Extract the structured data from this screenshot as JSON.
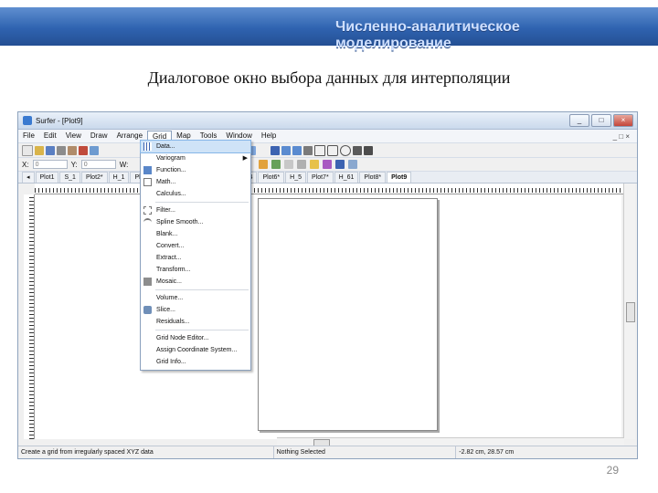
{
  "slide": {
    "banner_title": "Численно-аналитическое моделирование",
    "heading": "Диалоговое окно выбора данных для интерполяции",
    "page_number": "29"
  },
  "window": {
    "title": "Surfer - [Plot9]",
    "buttons": [
      "_",
      "□",
      "×"
    ]
  },
  "menubar": {
    "items": [
      "File",
      "Edit",
      "View",
      "Draw",
      "Arrange",
      "Grid",
      "Map",
      "Tools",
      "Window",
      "Help"
    ],
    "active": "Grid",
    "mdi_controls": "_ □ ×"
  },
  "coords": {
    "x_label": "X:",
    "x_value": "0",
    "y_label": "Y:",
    "y_value": "0",
    "w_label": "W:"
  },
  "tabs": {
    "left_items": [
      "Plot1",
      "S_1",
      "Plot2*",
      "H_1",
      "Plo"
    ],
    "right_items": [
      "H_4",
      "Plot6*",
      "H_5",
      "Plot7*",
      "H_61",
      "Plot8*",
      "Plot9"
    ],
    "active": "Plot9"
  },
  "grid_menu": {
    "items": [
      {
        "label": "Data...",
        "icon": "grid-data-icon",
        "highlight": true
      },
      {
        "label": "Variogram",
        "submenu": "▶"
      },
      {
        "label": "Function..."
      },
      {
        "label": "Math..."
      },
      {
        "label": "Calculus..."
      },
      {
        "label": "Filter..."
      },
      {
        "label": "Spline Smooth..."
      },
      {
        "label": "Blank..."
      },
      {
        "label": "Convert..."
      },
      {
        "label": "Extract..."
      },
      {
        "label": "Transform..."
      },
      {
        "label": "Mosaic..."
      },
      {
        "label": "Volume..."
      },
      {
        "label": "Slice..."
      },
      {
        "label": "Residuals..."
      },
      {
        "label": "Grid Node Editor..."
      },
      {
        "label": "Assign Coordinate System..."
      },
      {
        "label": "Grid Info..."
      }
    ]
  },
  "status": {
    "hint": "Create a grid from irregularly spaced XYZ data",
    "selection": "Nothing Selected",
    "position": "-2.82 cm, 28.57 cm"
  },
  "colors": {
    "banner": "#2f63b0",
    "highlight": "#cfe3f7"
  }
}
